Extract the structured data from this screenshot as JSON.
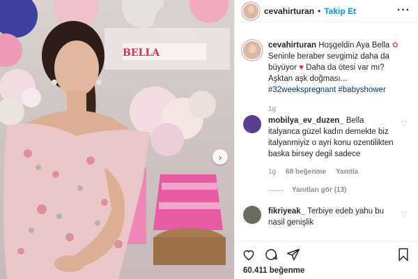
{
  "header": {
    "username": "cevahirturan",
    "separator": "•",
    "follow_label": "Takip Et",
    "more_icon": "more-horizontal-icon"
  },
  "caption": {
    "username": "cevahirturan",
    "text_line1": "Hoşgeldin Aya Bella",
    "text_line2": "Seninle beraber sevgimiz daha da büyüyor",
    "text_line3": "Daha da ötesi var mı? Aşktan aşk doğması...",
    "hashtag1": "#32weekspregnant",
    "hashtag2": "#babyshower",
    "time": "1g",
    "flower_emoji": "✿",
    "heart_emoji": "♥"
  },
  "comments": [
    {
      "username": "mobilya_ev_duzen_",
      "text": "Bella italyanca güzel kadın demekte biz italyanmiyiz o ayri konu ozentilikten baska birsey degil sadece",
      "time": "1g",
      "likes": "68 beğenme",
      "reply_label": "Yanıtla",
      "view_replies": "Yanıtları gör (13)"
    },
    {
      "username": "fikriyeak_",
      "text": "Terbiye edeb yahu bu nasil genişlik"
    }
  ],
  "actions": {
    "like_icon": "heart-icon",
    "comment_icon": "comment-icon",
    "share_icon": "share-icon",
    "save_icon": "bookmark-icon",
    "likes_count": "60.411 beğenme"
  },
  "photo": {
    "banner_text": "BELLA",
    "next_icon": "chevron-right-icon"
  },
  "colors": {
    "link_blue": "#0095f6",
    "hashtag_blue": "#00376b",
    "meta_gray": "#8e8e8e",
    "heart_red": "#e0245e"
  }
}
